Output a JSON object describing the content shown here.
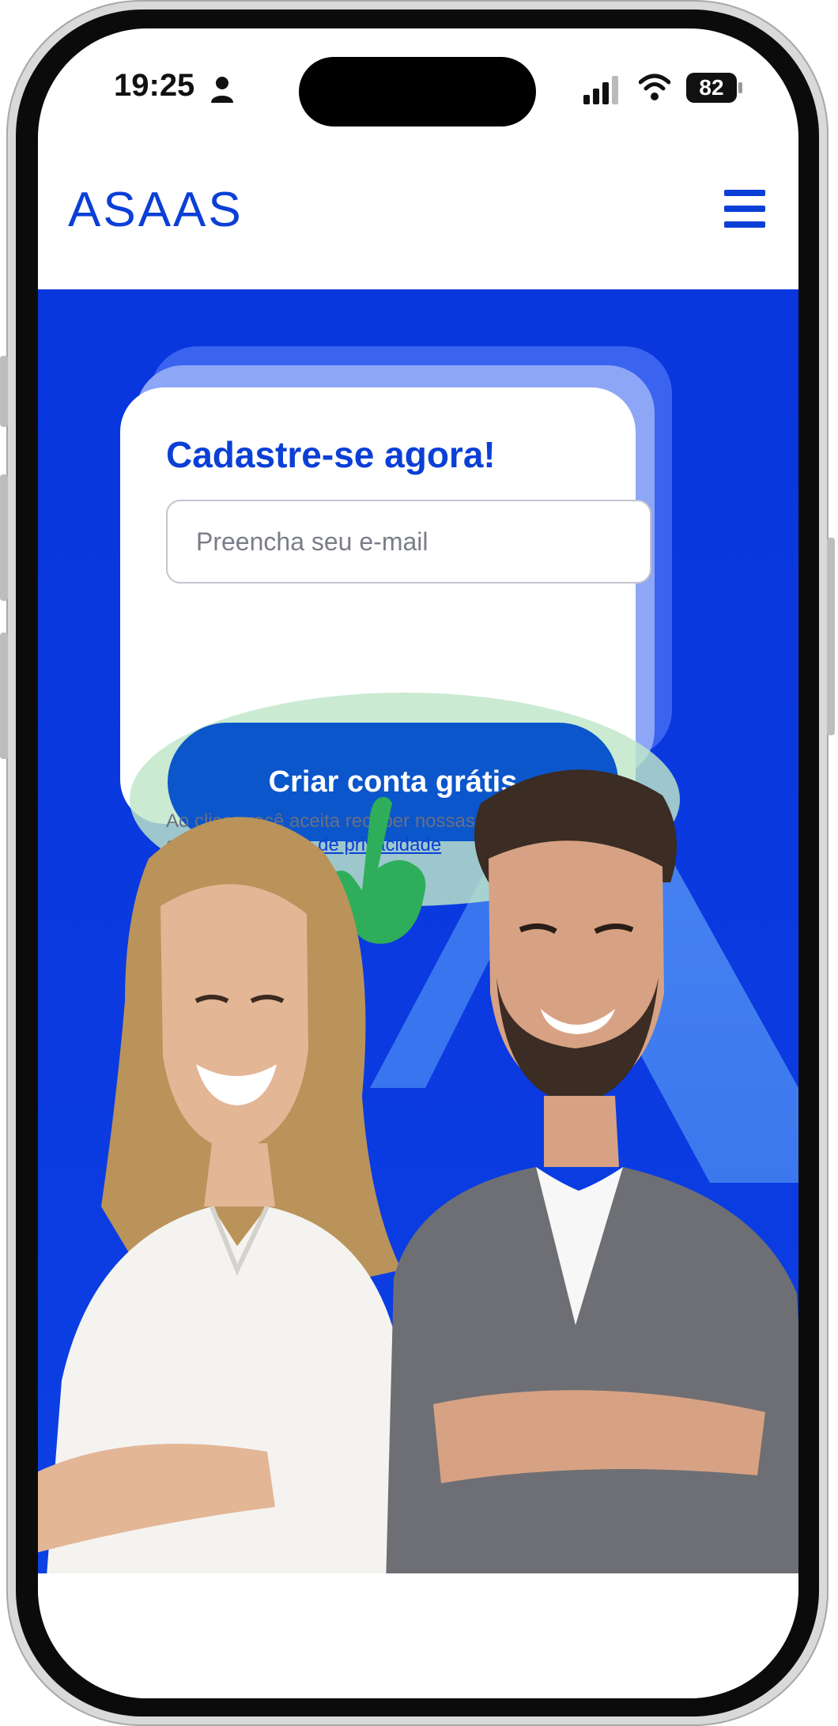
{
  "status_bar": {
    "time": "19:25",
    "battery": "82",
    "icons": [
      "person-icon",
      "signal-icon",
      "wifi-icon",
      "battery-icon"
    ]
  },
  "header": {
    "logo": "ASAAS",
    "menu_icon": "hamburger-menu-icon"
  },
  "signup": {
    "title": "Cadastre-se agora!",
    "email_placeholder": "Preencha seu e-mail",
    "email_value": "",
    "cta_label": "Criar conta grátis",
    "consent_prefix": "Ao clicar você aceita receber nossas comunicações, conforme ",
    "consent_link": "Política de privacidade"
  },
  "overlay": {
    "tap_indicator_icon": "pointing-hand-icon"
  },
  "colors": {
    "brand_blue": "#0b3fd6",
    "hero_blue": "#0a3ae0",
    "cta_blue": "#0c56cb",
    "tap_highlight": "#bee6c8",
    "hand_green": "#2eae5a"
  }
}
